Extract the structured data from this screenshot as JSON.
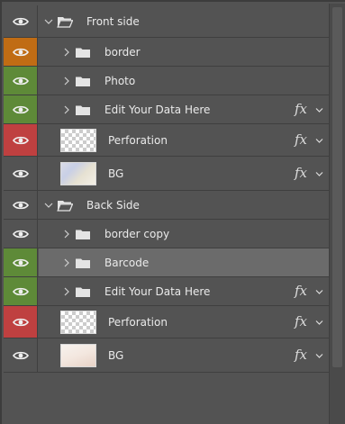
{
  "layers": [
    {
      "id": "front-side",
      "name": "Front side",
      "kind": "group-open",
      "indent": 0,
      "eye": "none",
      "fx": false,
      "selected": false
    },
    {
      "id": "border",
      "name": "border",
      "kind": "group",
      "indent": 1,
      "eye": "orange",
      "fx": false,
      "selected": false
    },
    {
      "id": "photo",
      "name": "Photo",
      "kind": "group",
      "indent": 1,
      "eye": "green",
      "fx": false,
      "selected": false
    },
    {
      "id": "edit-data-front",
      "name": "Edit Your Data Here",
      "kind": "group",
      "indent": 1,
      "eye": "green",
      "fx": true,
      "selected": false
    },
    {
      "id": "perforation-front",
      "name": "Perforation",
      "kind": "layer",
      "thumb": "checker",
      "eye": "red",
      "fx": true,
      "selected": false
    },
    {
      "id": "bg-front",
      "name": "BG",
      "kind": "layer",
      "thumb": "bg1",
      "eye": "none",
      "fx": true,
      "selected": false
    },
    {
      "id": "back-side",
      "name": "Back Side",
      "kind": "group-open",
      "indent": 0,
      "eye": "none",
      "fx": false,
      "selected": false
    },
    {
      "id": "border-copy",
      "name": "border copy",
      "kind": "group",
      "indent": 1,
      "eye": "none",
      "fx": false,
      "selected": false
    },
    {
      "id": "barcode",
      "name": "Barcode",
      "kind": "group",
      "indent": 1,
      "eye": "green",
      "fx": false,
      "selected": true
    },
    {
      "id": "edit-data-back",
      "name": "Edit Your Data Here",
      "kind": "group",
      "indent": 1,
      "eye": "green",
      "fx": true,
      "selected": false
    },
    {
      "id": "perforation-back",
      "name": "Perforation",
      "kind": "layer",
      "thumb": "checker",
      "eye": "red",
      "fx": true,
      "selected": false
    },
    {
      "id": "bg-back",
      "name": "BG",
      "kind": "layer",
      "thumb": "bg2",
      "eye": "none",
      "fx": true,
      "selected": false
    }
  ],
  "fx_label": "fx",
  "colors": {
    "eye_orange": "#c06c14",
    "eye_green": "#5e8a38",
    "eye_red": "#bf4040",
    "panel_bg": "#535353",
    "selected_bg": "#6b6b6b"
  },
  "icons": {
    "visibility": "eye-icon",
    "folder": "folder-icon",
    "expand": "chevron-right-icon",
    "collapse": "chevron-down-icon",
    "effects": "fx-icon",
    "effects_menu": "caret-down-icon"
  }
}
